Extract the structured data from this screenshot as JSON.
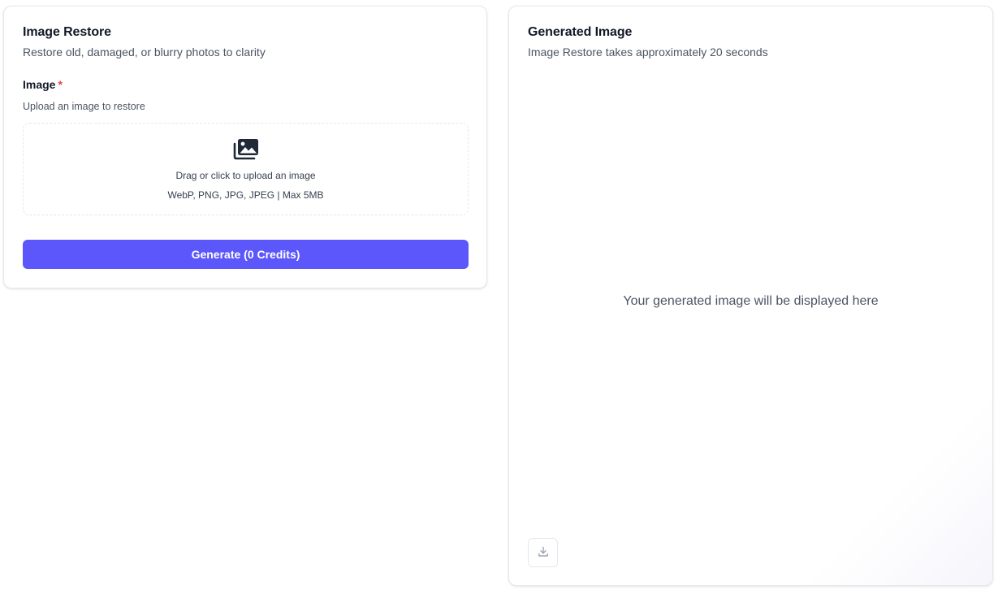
{
  "left_panel": {
    "title": "Image Restore",
    "subtitle": "Restore old, damaged, or blurry photos to clarity",
    "image_field": {
      "label": "Image",
      "required_mark": "*",
      "hint": "Upload an image to restore"
    },
    "dropzone": {
      "icon": "image-stack-icon",
      "text": "Drag or click to upload an image",
      "formats": "WebP, PNG, JPG, JPEG | Max 5MB"
    },
    "generate_button": "Generate (0 Credits)"
  },
  "right_panel": {
    "title": "Generated Image",
    "subtitle": "Image Restore takes approximately 20 seconds",
    "placeholder": "Your generated image will be displayed here",
    "download_icon": "download-icon"
  },
  "colors": {
    "accent": "#5b57fb",
    "required": "#ef4444",
    "border": "#e5e7eb",
    "muted_text": "#4b5563"
  }
}
